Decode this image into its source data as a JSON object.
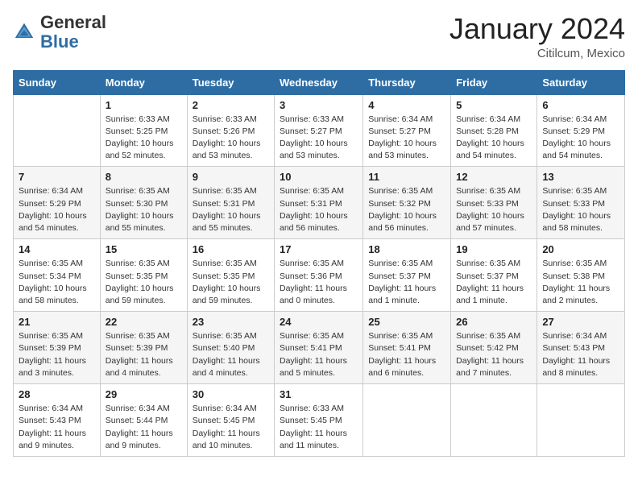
{
  "header": {
    "logo_general": "General",
    "logo_blue": "Blue",
    "month_year": "January 2024",
    "location": "Citilcum, Mexico"
  },
  "days_of_week": [
    "Sunday",
    "Monday",
    "Tuesday",
    "Wednesday",
    "Thursday",
    "Friday",
    "Saturday"
  ],
  "weeks": [
    [
      {
        "day": "",
        "info": ""
      },
      {
        "day": "1",
        "info": "Sunrise: 6:33 AM\nSunset: 5:25 PM\nDaylight: 10 hours\nand 52 minutes."
      },
      {
        "day": "2",
        "info": "Sunrise: 6:33 AM\nSunset: 5:26 PM\nDaylight: 10 hours\nand 53 minutes."
      },
      {
        "day": "3",
        "info": "Sunrise: 6:33 AM\nSunset: 5:27 PM\nDaylight: 10 hours\nand 53 minutes."
      },
      {
        "day": "4",
        "info": "Sunrise: 6:34 AM\nSunset: 5:27 PM\nDaylight: 10 hours\nand 53 minutes."
      },
      {
        "day": "5",
        "info": "Sunrise: 6:34 AM\nSunset: 5:28 PM\nDaylight: 10 hours\nand 54 minutes."
      },
      {
        "day": "6",
        "info": "Sunrise: 6:34 AM\nSunset: 5:29 PM\nDaylight: 10 hours\nand 54 minutes."
      }
    ],
    [
      {
        "day": "7",
        "info": "Sunrise: 6:34 AM\nSunset: 5:29 PM\nDaylight: 10 hours\nand 54 minutes."
      },
      {
        "day": "8",
        "info": "Sunrise: 6:35 AM\nSunset: 5:30 PM\nDaylight: 10 hours\nand 55 minutes."
      },
      {
        "day": "9",
        "info": "Sunrise: 6:35 AM\nSunset: 5:31 PM\nDaylight: 10 hours\nand 55 minutes."
      },
      {
        "day": "10",
        "info": "Sunrise: 6:35 AM\nSunset: 5:31 PM\nDaylight: 10 hours\nand 56 minutes."
      },
      {
        "day": "11",
        "info": "Sunrise: 6:35 AM\nSunset: 5:32 PM\nDaylight: 10 hours\nand 56 minutes."
      },
      {
        "day": "12",
        "info": "Sunrise: 6:35 AM\nSunset: 5:33 PM\nDaylight: 10 hours\nand 57 minutes."
      },
      {
        "day": "13",
        "info": "Sunrise: 6:35 AM\nSunset: 5:33 PM\nDaylight: 10 hours\nand 58 minutes."
      }
    ],
    [
      {
        "day": "14",
        "info": "Sunrise: 6:35 AM\nSunset: 5:34 PM\nDaylight: 10 hours\nand 58 minutes."
      },
      {
        "day": "15",
        "info": "Sunrise: 6:35 AM\nSunset: 5:35 PM\nDaylight: 10 hours\nand 59 minutes."
      },
      {
        "day": "16",
        "info": "Sunrise: 6:35 AM\nSunset: 5:35 PM\nDaylight: 10 hours\nand 59 minutes."
      },
      {
        "day": "17",
        "info": "Sunrise: 6:35 AM\nSunset: 5:36 PM\nDaylight: 11 hours\nand 0 minutes."
      },
      {
        "day": "18",
        "info": "Sunrise: 6:35 AM\nSunset: 5:37 PM\nDaylight: 11 hours\nand 1 minute."
      },
      {
        "day": "19",
        "info": "Sunrise: 6:35 AM\nSunset: 5:37 PM\nDaylight: 11 hours\nand 1 minute."
      },
      {
        "day": "20",
        "info": "Sunrise: 6:35 AM\nSunset: 5:38 PM\nDaylight: 11 hours\nand 2 minutes."
      }
    ],
    [
      {
        "day": "21",
        "info": "Sunrise: 6:35 AM\nSunset: 5:39 PM\nDaylight: 11 hours\nand 3 minutes."
      },
      {
        "day": "22",
        "info": "Sunrise: 6:35 AM\nSunset: 5:39 PM\nDaylight: 11 hours\nand 4 minutes."
      },
      {
        "day": "23",
        "info": "Sunrise: 6:35 AM\nSunset: 5:40 PM\nDaylight: 11 hours\nand 4 minutes."
      },
      {
        "day": "24",
        "info": "Sunrise: 6:35 AM\nSunset: 5:41 PM\nDaylight: 11 hours\nand 5 minutes."
      },
      {
        "day": "25",
        "info": "Sunrise: 6:35 AM\nSunset: 5:41 PM\nDaylight: 11 hours\nand 6 minutes."
      },
      {
        "day": "26",
        "info": "Sunrise: 6:35 AM\nSunset: 5:42 PM\nDaylight: 11 hours\nand 7 minutes."
      },
      {
        "day": "27",
        "info": "Sunrise: 6:34 AM\nSunset: 5:43 PM\nDaylight: 11 hours\nand 8 minutes."
      }
    ],
    [
      {
        "day": "28",
        "info": "Sunrise: 6:34 AM\nSunset: 5:43 PM\nDaylight: 11 hours\nand 9 minutes."
      },
      {
        "day": "29",
        "info": "Sunrise: 6:34 AM\nSunset: 5:44 PM\nDaylight: 11 hours\nand 9 minutes."
      },
      {
        "day": "30",
        "info": "Sunrise: 6:34 AM\nSunset: 5:45 PM\nDaylight: 11 hours\nand 10 minutes."
      },
      {
        "day": "31",
        "info": "Sunrise: 6:33 AM\nSunset: 5:45 PM\nDaylight: 11 hours\nand 11 minutes."
      },
      {
        "day": "",
        "info": ""
      },
      {
        "day": "",
        "info": ""
      },
      {
        "day": "",
        "info": ""
      }
    ]
  ]
}
